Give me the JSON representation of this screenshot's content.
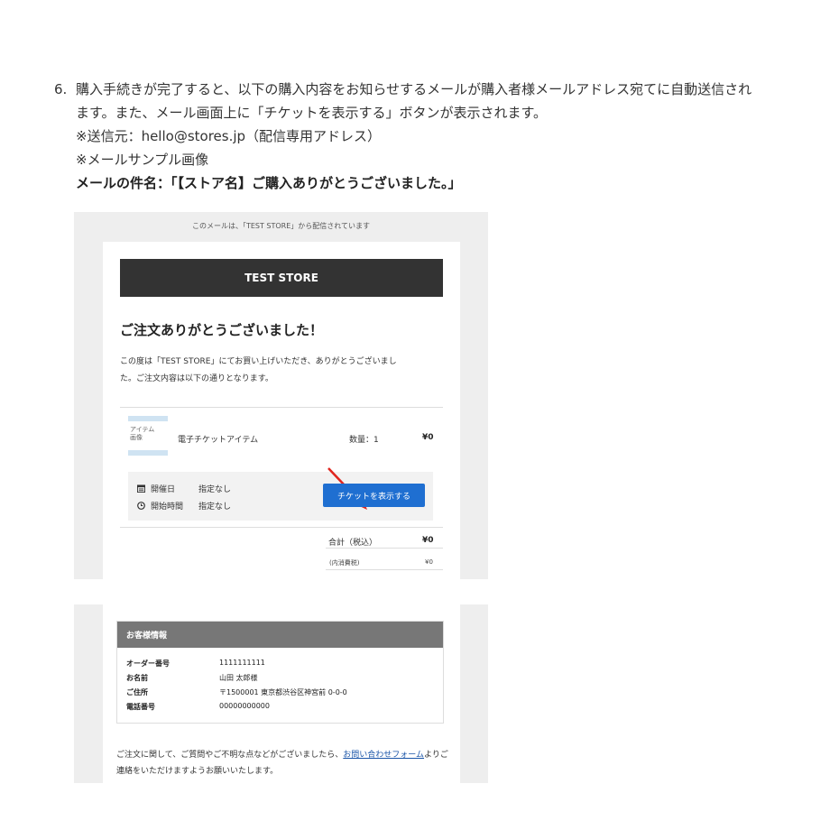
{
  "instruction": {
    "number": "6.",
    "line1": "購入手続きが完了すると、以下の購入内容をお知らせするメールが購入者様メールアドレス宛てに自動送信され",
    "line2": "ます。また、メール画面上に「チケットを表示する」ボタンが表示されます。",
    "line3": "※送信元：hello@stores.jp（配信専用アドレス）",
    "line4": "※メールサンプル画像",
    "subject": "メールの件名：「【ストア名】ご購入ありがとうございました。」"
  },
  "email1": {
    "notice": "このメールは、「TEST STORE」から配信されています",
    "store_name": "TEST STORE",
    "thanks": "ご注文ありがとうございました！",
    "message_line1": "この度は「TEST STORE」にてお買い上げいただき、ありがとうございまし",
    "message_line2": "た。ご注文内容は以下の通りとなります。",
    "item_image_label1": "アイテム",
    "item_image_label2": "画像",
    "item_name": "電子チケットアイテム",
    "quantity": "数量：1",
    "price": "¥0",
    "event_date_label": "開催日",
    "event_date_value": "指定なし",
    "start_time_label": "開始時間",
    "start_time_value": "指定なし",
    "ticket_button": "チケットを表示する",
    "total_label": "合計（税込）",
    "total_value": "¥0",
    "tax_label": "(内消費税)",
    "tax_value": "¥0"
  },
  "email2": {
    "customer_info_title": "お客様情報",
    "rows": [
      {
        "label": "オーダー番号",
        "value": "1111111111"
      },
      {
        "label": "お名前",
        "value": "山田 太郎様"
      },
      {
        "label": "ご住所",
        "value": "〒1500001 東京都渋谷区神宮前 0-0-0"
      },
      {
        "label": "電話番号",
        "value": "00000000000"
      }
    ],
    "footer_before": "ご注文に関して、ご質問やご不明な点などがございましたら、",
    "footer_link": "お問い合わせフォーム",
    "footer_after": "よりご連絡をいただけますようお願いいたします。"
  },
  "colors": {
    "store_bar": "#333333",
    "ticket_button": "#1f6fd1",
    "arrow": "#e0261f",
    "info_header": "#777777",
    "link": "#1a55a8"
  },
  "icons": [
    "calendar-icon",
    "clock-icon",
    "red-arrow-annotation"
  ]
}
